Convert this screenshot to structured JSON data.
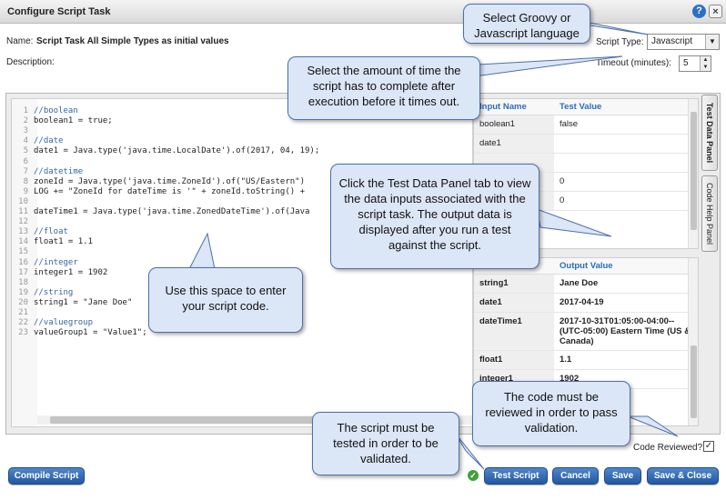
{
  "dialog": {
    "title": "Configure Script Task",
    "help_icon": "?",
    "close_icon": "×"
  },
  "form": {
    "name_label": "Name:",
    "name_value": "Script Task All Simple Types as initial values",
    "description_label": "Description:",
    "script_type_label": "Script Type:",
    "script_type_value": "Javascript",
    "timeout_label": "Timeout (minutes):",
    "timeout_value": "5"
  },
  "code": {
    "lines": [
      {
        "n": "1",
        "t": "//boolean",
        "k": "comment"
      },
      {
        "n": "2",
        "t": "boolean1 = true;",
        "k": "plain"
      },
      {
        "n": "3",
        "t": "",
        "k": "plain"
      },
      {
        "n": "4",
        "t": "//date",
        "k": "comment"
      },
      {
        "n": "5",
        "t": "date1 = Java.type('java.time.LocalDate').of(2017, 04, 19);",
        "k": "plain"
      },
      {
        "n": "6",
        "t": "",
        "k": "plain"
      },
      {
        "n": "7",
        "t": "//datetime",
        "k": "comment"
      },
      {
        "n": "8",
        "t": "zoneId = Java.type('java.time.ZoneId').of(\"US/Eastern\")",
        "k": "plain"
      },
      {
        "n": "9",
        "t": "LOG += \"ZoneId for dateTime is '\" + zoneId.toString() +",
        "k": "plain"
      },
      {
        "n": "10",
        "t": "",
        "k": "plain"
      },
      {
        "n": "11",
        "t": "dateTime1 = Java.type('java.time.ZonedDateTime').of(Java",
        "k": "plain"
      },
      {
        "n": "12",
        "t": "",
        "k": "plain"
      },
      {
        "n": "13",
        "t": "//float",
        "k": "comment"
      },
      {
        "n": "14",
        "t": "float1 = 1.1",
        "k": "plain"
      },
      {
        "n": "15",
        "t": "",
        "k": "plain"
      },
      {
        "n": "16",
        "t": "//integer",
        "k": "comment"
      },
      {
        "n": "17",
        "t": "integer1 = 1902",
        "k": "plain"
      },
      {
        "n": "18",
        "t": "",
        "k": "plain"
      },
      {
        "n": "19",
        "t": "//string",
        "k": "comment"
      },
      {
        "n": "20",
        "t": "string1 = \"Jane Doe\"",
        "k": "plain"
      },
      {
        "n": "21",
        "t": "",
        "k": "plain"
      },
      {
        "n": "22",
        "t": "//valuegroup",
        "k": "comment"
      },
      {
        "n": "23",
        "t": "valueGroup1 = \"Value1\";",
        "k": "plain"
      }
    ]
  },
  "input_table": {
    "headers": [
      "Input Name",
      "Test Value"
    ],
    "rows": [
      [
        "boolean1",
        "false"
      ],
      [
        "date1",
        ""
      ],
      [
        "",
        ""
      ],
      [
        "",
        "0"
      ],
      [
        "",
        "0"
      ]
    ]
  },
  "output_table": {
    "headers": [
      "",
      "Output Value"
    ],
    "rows": [
      [
        "string1",
        "Jane Doe"
      ],
      [
        "date1",
        "2017-04-19"
      ],
      [
        "dateTime1",
        "2017-10-31T01:05:00-04:00--(UTC-05:00) Eastern Time (US & Canada)"
      ],
      [
        "float1",
        "1.1"
      ],
      [
        "integer1",
        "1902"
      ]
    ]
  },
  "tabs": {
    "test_data": "Test Data Panel",
    "code_help": "Code Help Panel"
  },
  "callouts": {
    "language": "Select Groovy or Javascript language",
    "timeout": "Select the amount of time the script has to complete after execution before it times out.",
    "test_panel": "Click the Test Data Panel tab to view the data inputs associated with the script task. The output data is displayed after you run a test against the script.",
    "code_space": "Use this space to enter your script code.",
    "tested": "The script must be tested in order to be validated.",
    "reviewed": "The code must be reviewed in order to pass validation."
  },
  "footer": {
    "code_reviewed_label": "Code Reviewed?",
    "compile_label": "Compile Script",
    "test_label": "Test Script",
    "cancel_label": "Cancel",
    "save_label": "Save",
    "save_close_label": "Save & Close"
  },
  "colors": {
    "accent": "#2358a0",
    "callout_bg": "#dbe6f7",
    "valid": "#3fa33a"
  }
}
